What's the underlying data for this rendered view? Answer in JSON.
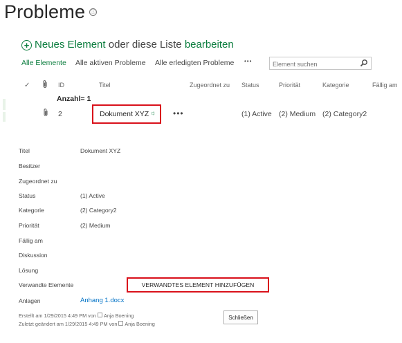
{
  "page": {
    "title": "Probleme",
    "info_icon": "ⓘ"
  },
  "new_item": {
    "icon": "plus-circle-icon",
    "new_label": "Neues Element",
    "middle_text": "oder diese Liste",
    "edit_label": "bearbeiten"
  },
  "views": {
    "all_items": "Alle Elemente",
    "active": "Alle aktiven Probleme",
    "done": "Alle erledigten Probleme",
    "more": "•••"
  },
  "search": {
    "placeholder": "Element suchen",
    "icon": "search-icon"
  },
  "columns": {
    "check": "✓",
    "attachment": "attachment-icon",
    "id": "ID",
    "title": "Titel",
    "assigned": "Zugeordnet zu",
    "status": "Status",
    "priority": "Priorität",
    "category": "Kategorie",
    "due": "Fällig am"
  },
  "group": {
    "label": "Anzahl",
    "value": "= 1"
  },
  "row": {
    "id": "2",
    "title": "Dokument XYZ",
    "new_marker": "☼",
    "ellipsis": "•••",
    "status": "(1) Active",
    "priority": "(2) Medium",
    "category": "(2) Category2"
  },
  "form": {
    "fields": [
      {
        "label": "Titel",
        "value": "Dokument XYZ"
      },
      {
        "label": "Besitzer",
        "value": ""
      },
      {
        "label": "Zugeordnet zu",
        "value": ""
      },
      {
        "label": "Status",
        "value": "(1) Active"
      },
      {
        "label": "Kategorie",
        "value": "(2) Category2"
      },
      {
        "label": "Priorität",
        "value": "(2) Medium"
      },
      {
        "label": "Fällig am",
        "value": ""
      },
      {
        "label": "Diskussion",
        "value": ""
      },
      {
        "label": "Lösung",
        "value": ""
      },
      {
        "label": "Verwandte Elemente",
        "value": ""
      },
      {
        "label": "Anlagen",
        "value": ""
      }
    ],
    "add_related_button": "VERWANDTES ELEMENT HINZUFÜGEN",
    "attachment_link": "Anhang 1.docx",
    "created_prefix": "Erstellt am 1/29/2015 4:49 PM  von",
    "created_by": "Anja Boening",
    "modified_prefix": "Zuletzt geändert am 1/29/2015 4:49 PM  von",
    "modified_by": "Anja Boening",
    "close_button": "Schließen"
  },
  "colors": {
    "accent_green": "#0b7d3e",
    "highlight_red": "#d9101a",
    "link_blue": "#0072c6"
  }
}
